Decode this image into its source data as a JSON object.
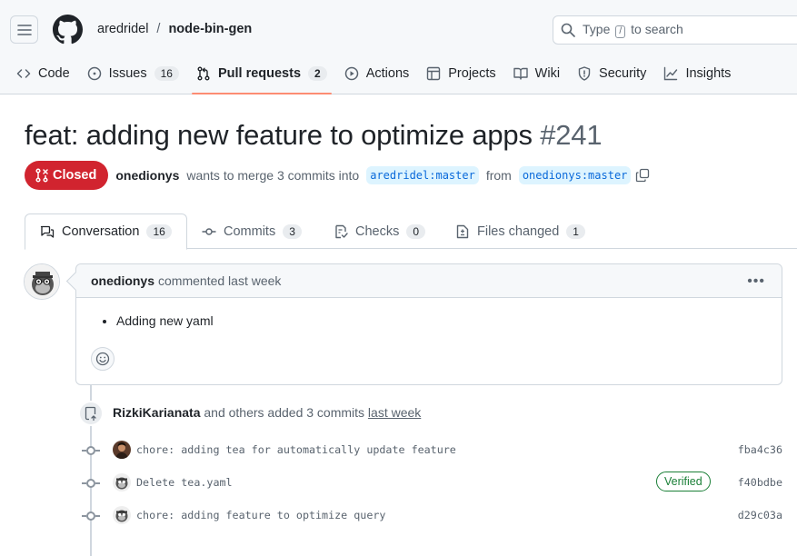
{
  "header": {
    "owner": "aredridel",
    "separator": "/",
    "repo": "node-bin-gen",
    "search_prefix": "Type",
    "search_key": "/",
    "search_suffix": "to search"
  },
  "repo_nav": [
    {
      "label": "Code",
      "icon": "code-icon"
    },
    {
      "label": "Issues",
      "icon": "issue-icon",
      "count": "16"
    },
    {
      "label": "Pull requests",
      "icon": "pull-request-icon",
      "count": "2",
      "active": true
    },
    {
      "label": "Actions",
      "icon": "play-icon"
    },
    {
      "label": "Projects",
      "icon": "table-icon"
    },
    {
      "label": "Wiki",
      "icon": "book-icon"
    },
    {
      "label": "Security",
      "icon": "shield-icon"
    },
    {
      "label": "Insights",
      "icon": "graph-icon"
    }
  ],
  "pr": {
    "title": "feat: adding new feature to optimize apps",
    "number": "#241",
    "state": "Closed",
    "author": "onedionys",
    "merge_text_1": "wants to merge 3 commits into",
    "base_branch": "aredridel:master",
    "merge_text_2": "from",
    "head_branch": "onedionys:master"
  },
  "tabs": [
    {
      "label": "Conversation",
      "count": "16",
      "icon": "comment-discussion-icon",
      "active": true
    },
    {
      "label": "Commits",
      "count": "3",
      "icon": "git-commit-icon"
    },
    {
      "label": "Checks",
      "count": "0",
      "icon": "checklist-icon"
    },
    {
      "label": "Files changed",
      "count": "1",
      "icon": "file-diff-icon"
    }
  ],
  "comment": {
    "author": "onedionys",
    "meta": "commented last week",
    "body_items": [
      "Adding new yaml"
    ]
  },
  "timeline": {
    "author": "RizkiKarianata",
    "text": "and others added 3 commits",
    "time": "last week",
    "commits": [
      {
        "message": "chore: adding tea for automatically update feature",
        "sha": "fba4c36",
        "verified": false
      },
      {
        "message": "Delete tea.yaml",
        "sha": "f40bdbe",
        "verified": true,
        "verified_label": "Verified"
      },
      {
        "message": "chore: adding feature to optimize query",
        "sha": "d29c03a",
        "verified": false
      }
    ]
  },
  "colors": {
    "closed": "#d1242f",
    "active_tab_underline": "#fd8c73",
    "branch_text": "#0969da",
    "verified": "#1a7f37"
  }
}
